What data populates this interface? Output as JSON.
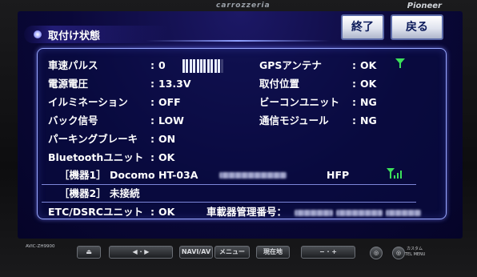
{
  "device": {
    "brand_top": "carrozzeria",
    "brand_right": "Pioneer",
    "model": "AVIC-ZH9900"
  },
  "screen": {
    "title": "取付け状態",
    "buttons": {
      "exit": "終了",
      "back": "戻る"
    }
  },
  "status": {
    "speed_pulse": {
      "label": "車速パルス",
      "value": "0",
      "level": 0.95
    },
    "voltage": {
      "label": "電源電圧",
      "value": "13.3V"
    },
    "illumination": {
      "label": "イルミネーション",
      "value": "OFF"
    },
    "back_signal": {
      "label": "バック信号",
      "value": "LOW"
    },
    "parking_brake": {
      "label": "パーキングブレーキ",
      "value": "ON"
    },
    "bluetooth": {
      "label": "Bluetoothユニット",
      "value": "OK"
    },
    "gps": {
      "label": "GPSアンテナ",
      "value": "OK"
    },
    "mount_position": {
      "label": "取付位置",
      "value": "OK"
    },
    "beacon": {
      "label": "ビーコンユニット",
      "value": "NG"
    },
    "comm_module": {
      "label": "通信モジュール",
      "value": "NG"
    },
    "device1": {
      "label": "［機器1］ Docomo HT-03A",
      "profile": "HFP"
    },
    "device2": {
      "label": "［機器2］ 未接続"
    },
    "etc": {
      "label": "ETC/DSRCユニット",
      "value": "OK",
      "vehicle_id_label": "車載器管理番号："
    }
  },
  "hardware": {
    "navi_av": "NAVI/AV",
    "menu": "メニュー",
    "current_location": "現在地",
    "minus": "−",
    "plus": "+",
    "custom": "カスタム",
    "tel_menu": "TEL MENU"
  },
  "colors": {
    "accent": "#3c32b4",
    "panel_border": "#9aa8ff",
    "signal_green": "#3ce15a",
    "button_text": "#0b1a5a"
  },
  "icons": {
    "gps": "gps-antenna-icon",
    "signal": "signal-strength-icon"
  }
}
